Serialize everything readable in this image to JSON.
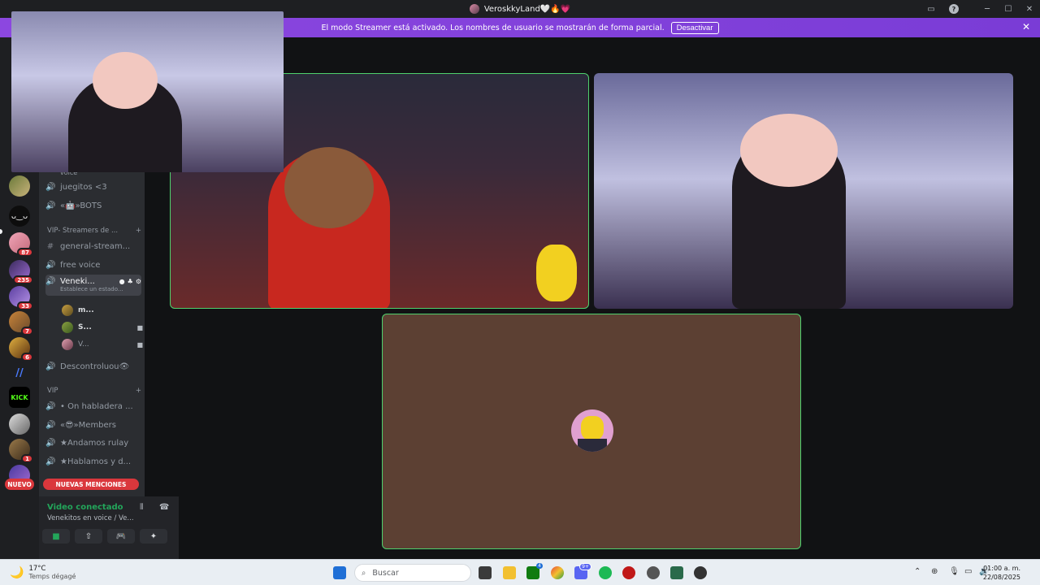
{
  "window": {
    "title": "VeroskkyLand🤍🔥💗",
    "buttons": [
      "inbox-icon",
      "help-icon",
      "minimize-icon",
      "maximize-icon",
      "close-icon"
    ]
  },
  "streamer_banner": {
    "message": "El modo Streamer está activado. Los nombres de usuario se mostrarán de forma parcial.",
    "button_label": "Desactivar"
  },
  "servers": {
    "badges": [
      "87",
      "235",
      "33",
      "7",
      "6",
      "1"
    ],
    "logo_text": "KICK"
  },
  "sidebar": {
    "top_label": "voice",
    "channels_top": [
      {
        "label": "juegitos <3",
        "icon": "speaker-icon"
      },
      {
        "label": "«🤖»BOTS",
        "icon": "speaker-icon"
      }
    ],
    "category_vip_streamers": "VIP- Streamers de ...",
    "channels_vip_streamers": [
      {
        "label": "general-stream...",
        "icon": "hash-icon"
      },
      {
        "label": "free voice",
        "icon": "speaker-icon"
      }
    ],
    "active_channel": {
      "label": "Veneki...",
      "status": "Establece un estado..."
    },
    "voice_users": [
      "m...",
      "S...",
      "V..."
    ],
    "channel_after_users": "Descontroluou👁",
    "category_vip": "VIP",
    "channels_vip": [
      {
        "label": "• On habladera ...",
        "icon": "speaker-icon"
      },
      {
        "label": "«😎»Members",
        "icon": "speaker-icon"
      },
      {
        "label": "★Andamos rulay",
        "icon": "speaker-icon"
      },
      {
        "label": "★Hablamos y d...",
        "icon": "speaker-icon"
      }
    ],
    "new_pill": "NUEVO",
    "mentions_pill": "NUEVAS MENCIONES",
    "voice_panel": {
      "status": "Video conectado",
      "channel": "Venekitos en voice / Ve..."
    }
  },
  "taskbar": {
    "weather_temp": "17°C",
    "weather_desc": "Temps dégagé",
    "search_placeholder": "Buscar",
    "time": "01:00 a. m.",
    "date": "22/08/2025",
    "discord_badge": "9+",
    "badge_4": "4"
  },
  "colors": {
    "banner": "#7d3fd9",
    "speaking": "#4fd16d",
    "badge": "#da373c",
    "tile_empty": "#5c4033"
  }
}
